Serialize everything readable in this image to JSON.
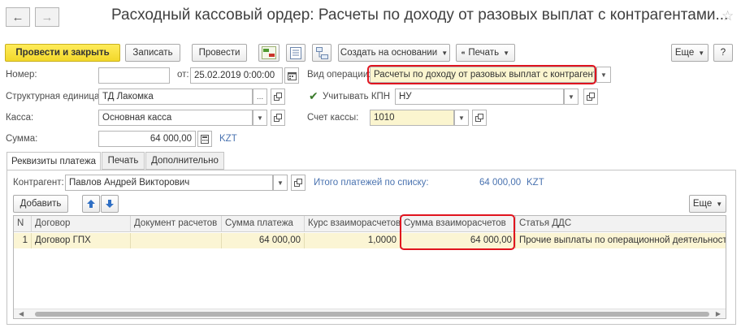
{
  "window": {
    "title": "Расходный кассовый ордер: Расчеты по доходу от разовых выплат с контрагентами...",
    "back": "←",
    "forward": "→",
    "star": "☆",
    "menu": "⋮",
    "restore": "□",
    "close": "×"
  },
  "toolbar": {
    "post_close": "Провести и закрыть",
    "save": "Записать",
    "post": "Провести",
    "create_based": "Создать на основании",
    "print": "Печать",
    "more": "Еще",
    "help": "?"
  },
  "form": {
    "number_label": "Номер:",
    "number_value": "",
    "date_label": "от:",
    "date_value": "25.02.2019  0:00:00",
    "operation_label": "Вид операции:",
    "operation_value": "Расчеты по доходу от разовых выплат с контрагента",
    "unit_label": "Структурная единица:",
    "unit_value": "ТД Лакомка",
    "kpn_label": "Учитывать КПН",
    "kpn_value": "НУ",
    "kassa_label": "Касса:",
    "kassa_value": "Основная касса",
    "account_label": "Счет кассы:",
    "account_value": "1010",
    "sum_label": "Сумма:",
    "sum_value": "64 000,00",
    "currency": "KZT"
  },
  "tabs": [
    {
      "label": "Реквизиты платежа"
    },
    {
      "label": "Печать"
    },
    {
      "label": "Дополнительно"
    }
  ],
  "payment": {
    "counterparty_label": "Контрагент:",
    "counterparty_value": "Павлов Андрей Викторович",
    "total_label": "Итого платежей по списку:",
    "total_value": "64 000,00",
    "total_currency": "KZT",
    "add": "Добавить",
    "more": "Еще"
  },
  "table": {
    "columns": [
      "N",
      "Договор",
      "Документ расчетов",
      "Сумма платежа",
      "Курс взаиморасчетов",
      "Сумма взаиморасчетов",
      "Статья ДДС"
    ],
    "rows": [
      [
        "1",
        "Договор ГПХ",
        "",
        "64 000,00",
        "1,0000",
        "64 000,00",
        "Прочие выплаты по операционной деятельности"
      ]
    ]
  }
}
